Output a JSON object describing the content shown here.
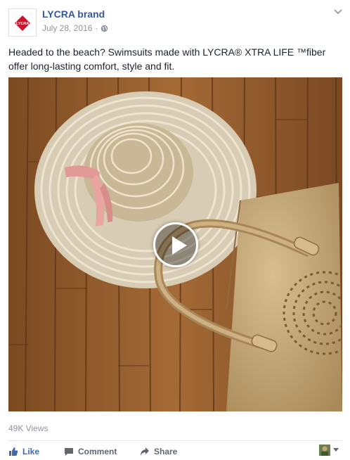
{
  "post": {
    "page_name": "LYCRA brand",
    "date": "July 28, 2016",
    "separator": "·",
    "logo_text": "LYCRA",
    "text_lines": [
      "Headed to the beach? Swimsuits made with LYCRA® XTRA LIFE ™fiber",
      "offer long-lasting comfort, style and fit."
    ],
    "views": "49K Views"
  },
  "actions": {
    "like": "Like",
    "comment": "Comment",
    "share": "Share"
  },
  "icons": {
    "audience": "globe-icon",
    "menu": "chevron-down-icon",
    "play": "play-icon",
    "like": "thumbs-up-icon",
    "comment": "comment-icon",
    "share": "share-icon"
  },
  "colors": {
    "brand_link": "#365899",
    "like_blue": "#4267b2",
    "logo_red": "#d0112b",
    "meta_grey": "#90949c"
  }
}
